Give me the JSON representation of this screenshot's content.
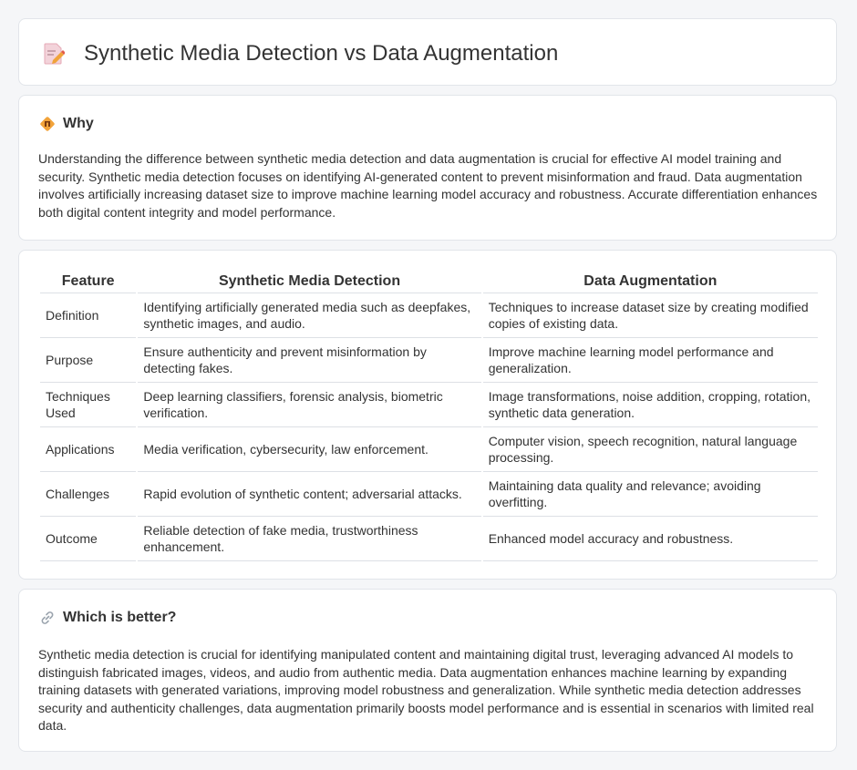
{
  "page": {
    "title": "Synthetic Media Detection vs Data Augmentation",
    "icons": {
      "header": "document-pencil-icon",
      "why": "diamond-signal-icon",
      "better": "link-icon"
    },
    "colors": {
      "accent": "#e8853a",
      "border": "#e2e5ea",
      "background": "#f5f6f8"
    }
  },
  "why": {
    "title": "Why",
    "text": "Understanding the difference between synthetic media detection and data augmentation is crucial for effective AI model training and security. Synthetic media detection focuses on identifying AI-generated content to prevent misinformation and fraud. Data augmentation involves artificially increasing dataset size to improve machine learning model accuracy and robustness. Accurate differentiation enhances both digital content integrity and model performance."
  },
  "table": {
    "headers": [
      "Feature",
      "Synthetic Media Detection",
      "Data Augmentation"
    ],
    "rows": [
      [
        "Definition",
        "Identifying artificially generated media such as deepfakes, synthetic images, and audio.",
        "Techniques to increase dataset size by creating modified copies of existing data."
      ],
      [
        "Purpose",
        "Ensure authenticity and prevent misinformation by detecting fakes.",
        "Improve machine learning model performance and generalization."
      ],
      [
        "Techniques Used",
        "Deep learning classifiers, forensic analysis, biometric verification.",
        "Image transformations, noise addition, cropping, rotation, synthetic data generation."
      ],
      [
        "Applications",
        "Media verification, cybersecurity, law enforcement.",
        "Computer vision, speech recognition, natural language processing."
      ],
      [
        "Challenges",
        "Rapid evolution of synthetic content; adversarial attacks.",
        "Maintaining data quality and relevance; avoiding overfitting."
      ],
      [
        "Outcome",
        "Reliable detection of fake media, trustworthiness enhancement.",
        "Enhanced model accuracy and robustness."
      ]
    ]
  },
  "better": {
    "title": "Which is better?",
    "text": "Synthetic media detection is crucial for identifying manipulated content and maintaining digital trust, leveraging advanced AI models to distinguish fabricated images, videos, and audio from authentic media. Data augmentation enhances machine learning by expanding training datasets with generated variations, improving model robustness and generalization. While synthetic media detection addresses security and authenticity challenges, data augmentation primarily boosts model performance and is essential in scenarios with limited real data."
  }
}
